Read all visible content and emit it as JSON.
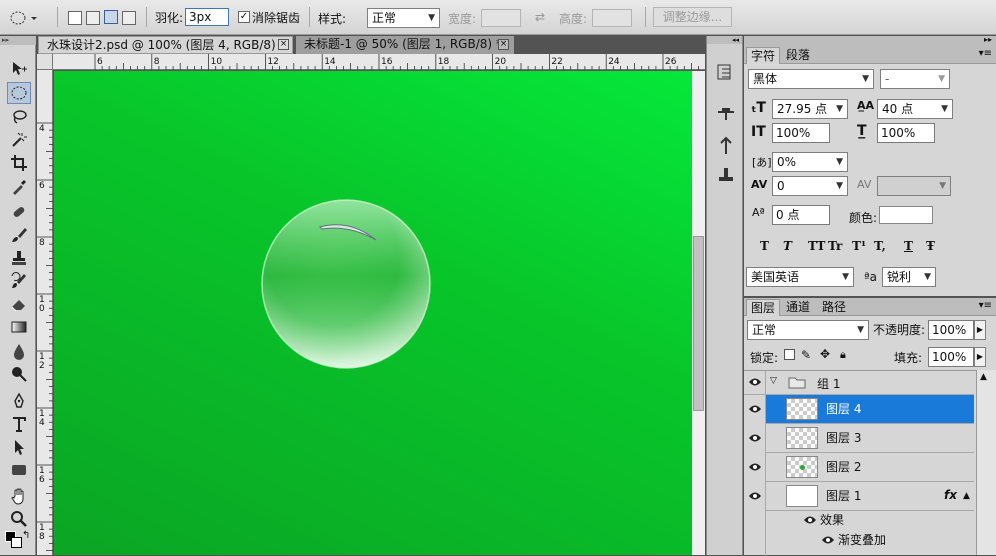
{
  "options": {
    "feather_label": "羽化:",
    "feather_value": "3px",
    "antialias_label": "消除锯齿",
    "style_label": "样式:",
    "style_value": "正常",
    "width_label": "宽度:",
    "height_label": "高度:",
    "refine_edge": "调整边缘..."
  },
  "tabs": [
    {
      "label": "水珠设计2.psd @ 100% (图层 4, RGB/8) *",
      "active": true
    },
    {
      "label": "未标题-1 @ 50% (图层 1, RGB/8) *",
      "active": false
    }
  ],
  "ruler_top": [
    "6",
    "8",
    "10",
    "12",
    "14",
    "16",
    "18",
    "20",
    "22",
    "24",
    "26"
  ],
  "ruler_left": [
    "4",
    "6",
    "8",
    "1 0",
    "1 2",
    "1 4",
    "1 6",
    "1 8"
  ],
  "character": {
    "tab_char": "字符",
    "tab_para": "段落",
    "font_family": "黑体",
    "font_style": "-",
    "font_size": "27.95 点",
    "leading": "40 点",
    "vscale": "100%",
    "hscale": "100%",
    "tsume": "0%",
    "tracking": "0",
    "baseline": "0 点",
    "color_label": "颜色:",
    "style_buttons": [
      "T",
      "T",
      "TT",
      "Tr",
      "T¹",
      "T,",
      "T",
      "Ŧ"
    ],
    "language": "美国英语",
    "aa_icon": "ªa",
    "aa_value": "锐利"
  },
  "layers": {
    "tab_layers": "图层",
    "tab_channels": "通道",
    "tab_paths": "路径",
    "blend_mode": "正常",
    "opacity_label": "不透明度:",
    "opacity": "100%",
    "lock_label": "锁定:",
    "fill_label": "填充:",
    "fill": "100%",
    "group_name": "组 1",
    "items": [
      {
        "name": "图层 4",
        "selected": true
      },
      {
        "name": "图层 3",
        "selected": false
      },
      {
        "name": "图层 2",
        "selected": false
      },
      {
        "name": "图层 1",
        "selected": false
      }
    ],
    "fx_label": "fx",
    "effects_label": "效果",
    "effect_item": "渐变叠加"
  },
  "colors": {
    "canvas_green": "#08c62a",
    "selection_blue": "#1e7fdc"
  }
}
